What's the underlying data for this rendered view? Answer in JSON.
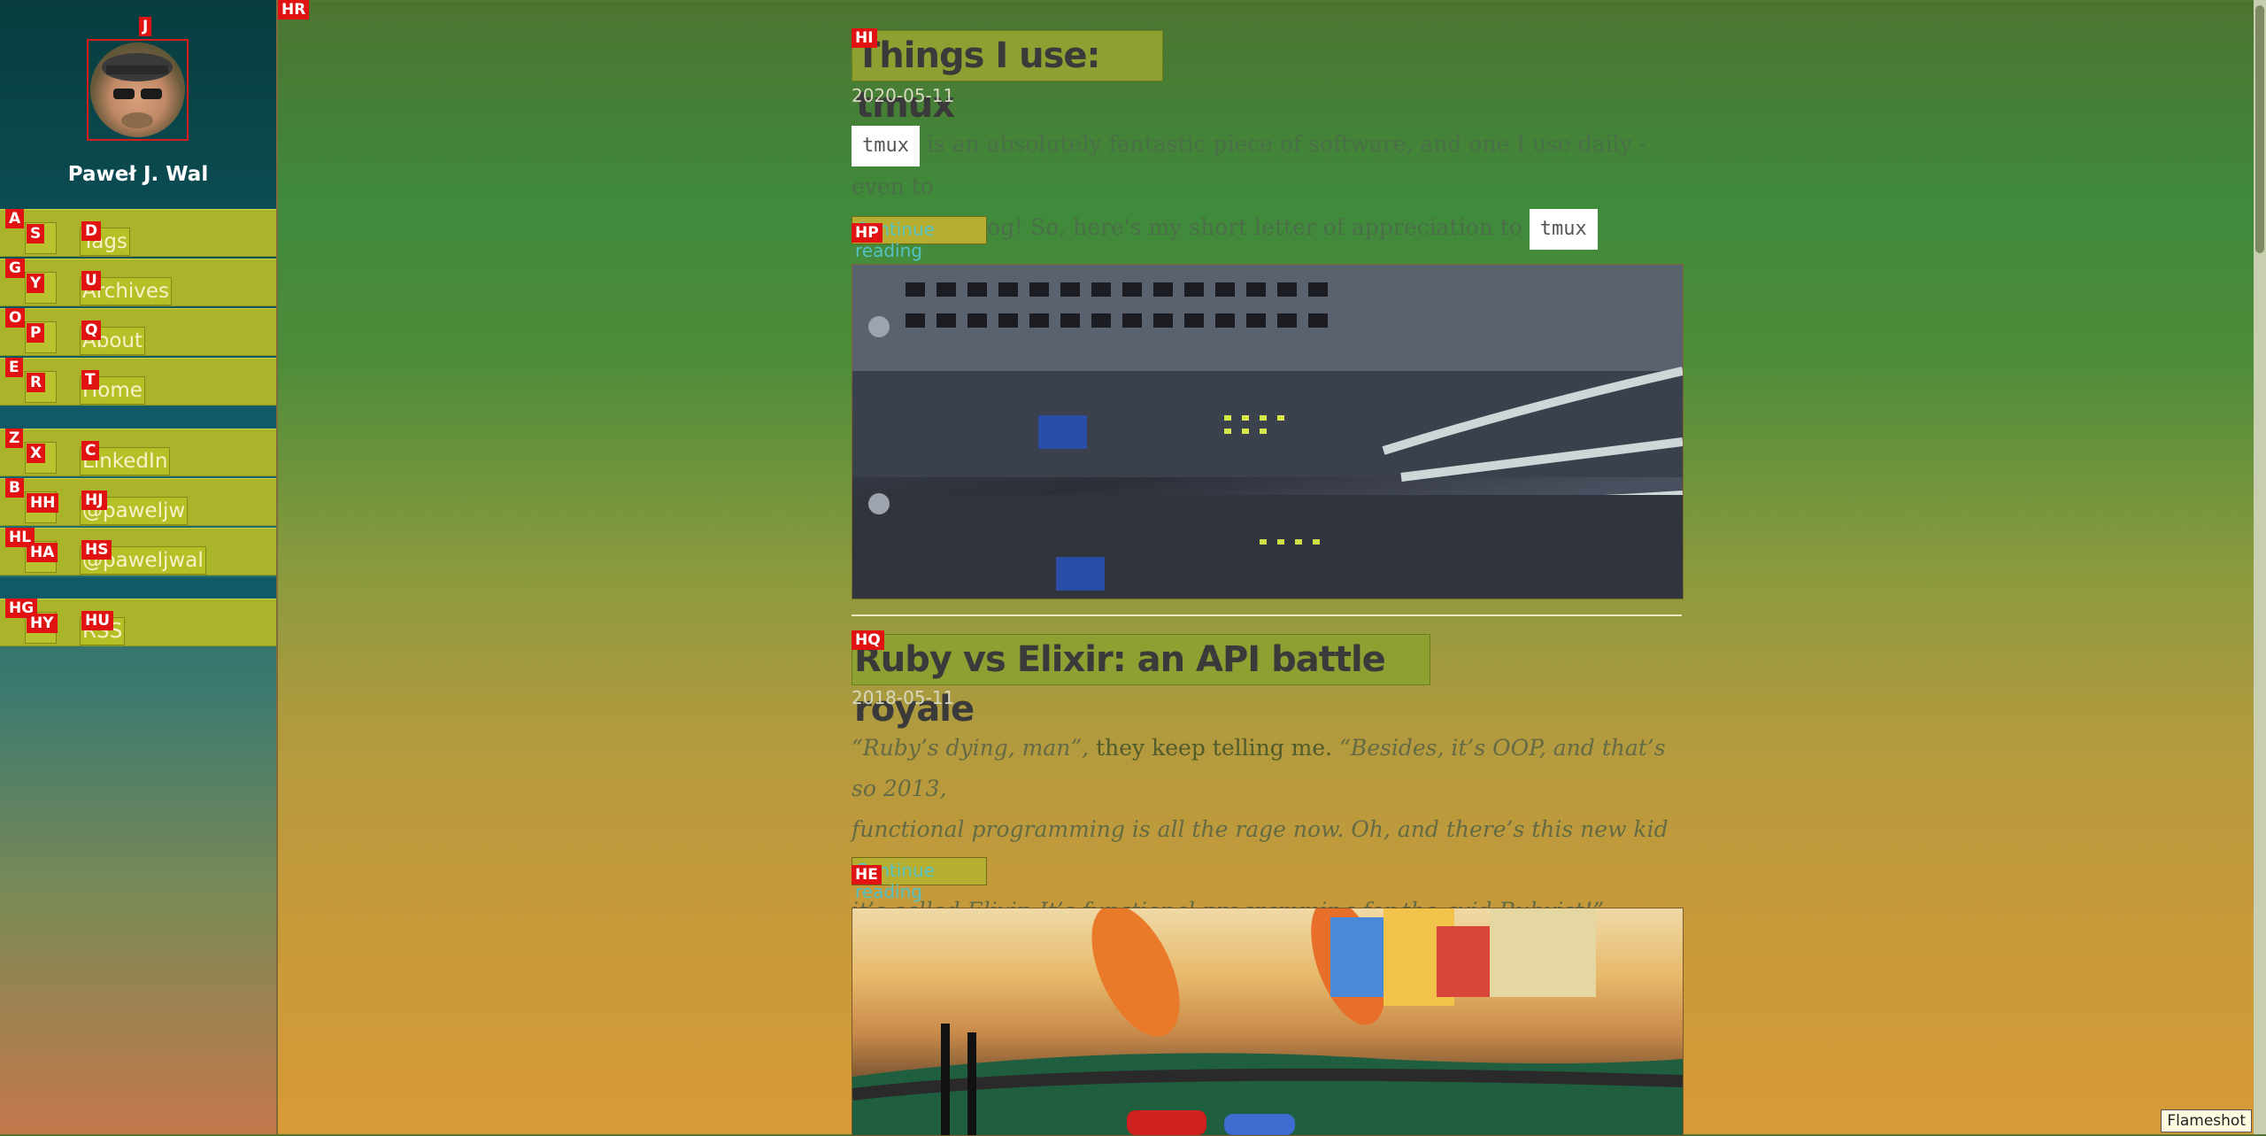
{
  "author": {
    "name": "Paweł J. Wal"
  },
  "nav": [
    {
      "label": "Tags",
      "icon": "tags-icon"
    },
    {
      "label": "Archives",
      "icon": "archive-icon"
    },
    {
      "label": "About",
      "icon": "question-icon"
    },
    {
      "label": "Home",
      "icon": "home-icon"
    }
  ],
  "social": [
    {
      "label": "LinkedIn",
      "icon": "linkedin-icon"
    },
    {
      "label": "@paweljw",
      "icon": "github-icon"
    },
    {
      "label": "@paweljwal",
      "icon": "twitter-icon"
    }
  ],
  "feed": {
    "label": "RSS",
    "icon": "rss-icon"
  },
  "hints": {
    "hr": "HR",
    "j": "J",
    "a": "A",
    "s": "S",
    "d": "D",
    "g": "G",
    "y": "Y",
    "u": "U",
    "o": "O",
    "p": "P",
    "q": "Q",
    "e": "E",
    "r": "R",
    "t": "T",
    "z": "Z",
    "x": "X",
    "c": "C",
    "b": "B",
    "hh": "HH",
    "hj": "HJ",
    "hl": "HL",
    "ha": "HA",
    "hs": "HS",
    "hg": "HG",
    "hy": "HY",
    "hu": "HU",
    "hi": "HI",
    "hp": "HP",
    "hq": "HQ",
    "he": "HE"
  },
  "posts": [
    {
      "title": "Things I use: tmux",
      "date": "2020-05-11",
      "code_word": "tmux",
      "excerpt_part1": "is an absolutely fantastic piece of software, and one I use daily - even to",
      "excerpt_part2": "write this blog! So, here's my short letter of appreciation to",
      "continue": "Continue reading"
    },
    {
      "title": "Ruby vs Elixir: an API battle royale",
      "date": "2018-05-11",
      "excerpt_1a": "“Ruby’s dying, man”,",
      "excerpt_1b": " they keep telling me. ",
      "excerpt_1c": "“Besides, it’s OOP, and that’s so 2013,",
      "excerpt_2": "functional programming is all the rage now. Oh, and there’s this new kid on the blog,",
      "excerpt_3": "it’s called Elixir. It’s functional programming for the avid Rubyist!”",
      "continue": "Continue reading"
    }
  ],
  "overlay": {
    "flameshot": "Flameshot"
  }
}
